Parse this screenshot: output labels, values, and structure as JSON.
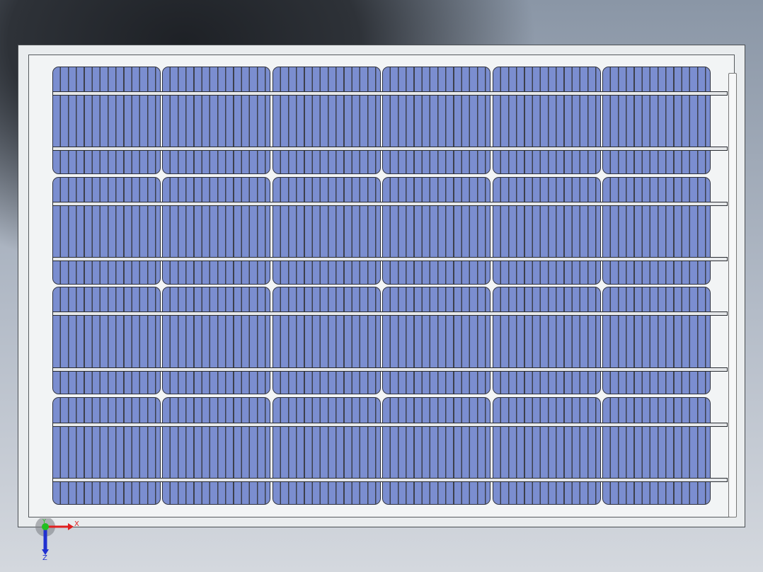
{
  "viewport": {
    "name": "solar-panel-model-view",
    "background": "#8a96a6"
  },
  "panel": {
    "rows": 4,
    "columns": 6,
    "cell_color": "#7b8ed0",
    "frame_color": "#e9ecee",
    "busbar_count": 8
  },
  "triad": {
    "x_label": "X",
    "y_label": "Y",
    "z_label": "Z",
    "x_color": "#e02020",
    "y_color": "#20c020",
    "z_color": "#2030d0"
  }
}
